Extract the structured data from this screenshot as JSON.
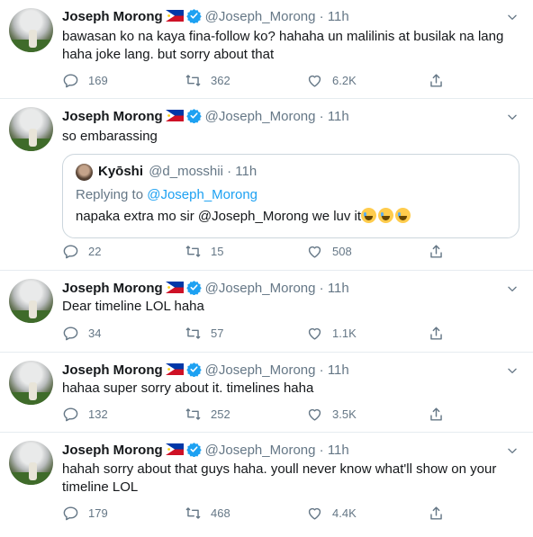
{
  "author": {
    "name": "Joseph Morong",
    "handle": "@Joseph_Morong",
    "flag_icon": "philippines-flag-icon",
    "verified_icon": "verified-badge-icon"
  },
  "colors": {
    "accent": "#1da1f2",
    "secondary_text": "#657786",
    "border": "#e6ecf0"
  },
  "tweets": [
    {
      "time": "· 11h",
      "text": "bawasan ko na kaya fina-follow ko? hahaha un malilinis at busilak na lang haha joke lang. but sorry about that",
      "replies": "169",
      "retweets": "362",
      "likes": "6.2K"
    },
    {
      "time": "· 11h",
      "text": "so embarassing",
      "replies": "22",
      "retweets": "15",
      "likes": "508",
      "quote": {
        "name": "Kyōshi",
        "handle": "@d_mosshii",
        "time": "· 11h",
        "replying_prefix": "Replying to ",
        "replying_to": "@Joseph_Morong",
        "text": "napaka extra mo sir @Joseph_Morong we luv it",
        "emoji": "face-with-tears-of-joy-icon"
      }
    },
    {
      "time": "· 11h",
      "text": "Dear timeline LOL haha",
      "replies": "34",
      "retweets": "57",
      "likes": "1.1K"
    },
    {
      "time": "· 11h",
      "text": "hahaa super sorry about it. timelines haha",
      "replies": "132",
      "retweets": "252",
      "likes": "3.5K"
    },
    {
      "time": "· 11h",
      "text": "hahah sorry about that guys haha. youll never know what'll show on your timeline LOL",
      "replies": "179",
      "retweets": "468",
      "likes": "4.4K"
    }
  ]
}
